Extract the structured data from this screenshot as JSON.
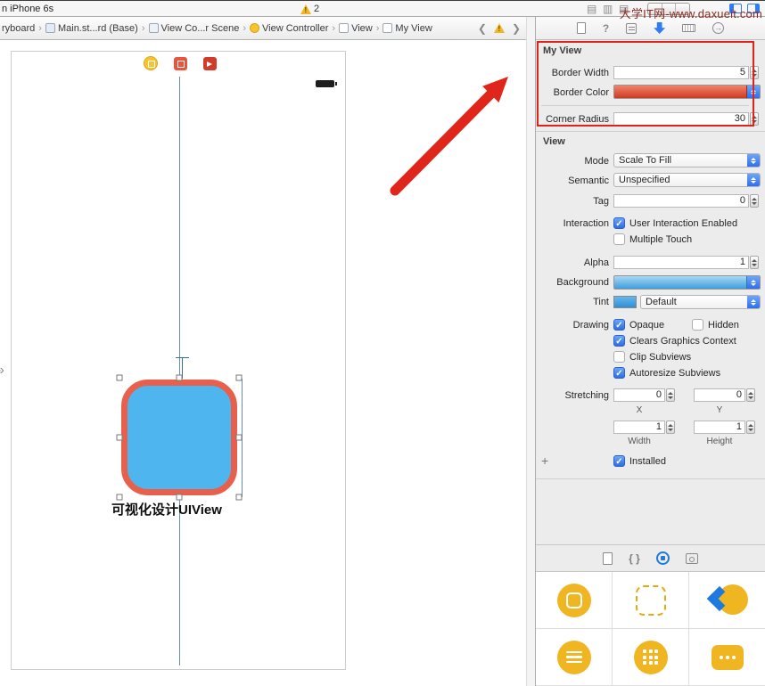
{
  "watermark": "大学IT网-www.daxueit.com",
  "toolbar": {
    "device": "n iPhone 6s",
    "warning_count": "2"
  },
  "jumpbar": {
    "items": [
      {
        "label": "ryboard"
      },
      {
        "label": "Main.st...rd (Base)"
      },
      {
        "label": "View Co...r Scene"
      },
      {
        "label": "View Controller"
      },
      {
        "label": "View"
      },
      {
        "label": "My View"
      }
    ]
  },
  "canvas": {
    "caption": "可视化设计UIView"
  },
  "inspector": {
    "my_view": {
      "title": "My View",
      "border_width": {
        "label": "Border Width",
        "value": "5"
      },
      "border_color": {
        "label": "Border Color"
      },
      "corner_radius": {
        "label": "Corner Radius",
        "value": "30"
      }
    },
    "view": {
      "title": "View",
      "mode": {
        "label": "Mode",
        "value": "Scale To Fill"
      },
      "semantic": {
        "label": "Semantic",
        "value": "Unspecified"
      },
      "tag": {
        "label": "Tag",
        "value": "0"
      },
      "interaction": {
        "label": "Interaction",
        "user_interaction": "User Interaction Enabled",
        "user_interaction_checked": true,
        "multiple_touch": "Multiple Touch",
        "multiple_touch_checked": false
      },
      "alpha": {
        "label": "Alpha",
        "value": "1"
      },
      "background": {
        "label": "Background"
      },
      "tint": {
        "label": "Tint",
        "value": "Default"
      },
      "drawing": {
        "label": "Drawing",
        "opaque": "Opaque",
        "opaque_checked": true,
        "hidden": "Hidden",
        "hidden_checked": false,
        "clears": "Clears Graphics Context",
        "clears_checked": true,
        "clip": "Clip Subviews",
        "clip_checked": false,
        "autoresize": "Autoresize Subviews",
        "autoresize_checked": true
      },
      "stretching": {
        "label": "Stretching",
        "x": {
          "label": "X",
          "value": "0"
        },
        "y": {
          "label": "Y",
          "value": "0"
        },
        "width": {
          "label": "Width",
          "value": "1"
        },
        "height": {
          "label": "Height",
          "value": "1"
        }
      },
      "installed": {
        "label": "Installed",
        "checked": true
      }
    }
  },
  "library": {
    "items": [
      {
        "name": "view-controller"
      },
      {
        "name": "storyboard-reference"
      },
      {
        "name": "navigation-back"
      },
      {
        "name": "table-view-controller"
      },
      {
        "name": "collection-view-controller"
      },
      {
        "name": "page-control"
      }
    ]
  },
  "colors": {
    "accent_blue": "#2d6ff0",
    "view_fill": "#4FB5EE",
    "view_border": "#E8604C",
    "arrow_red": "#E0261A",
    "highlight_red": "#E0231A",
    "icon_yellow": "#F0B622"
  }
}
